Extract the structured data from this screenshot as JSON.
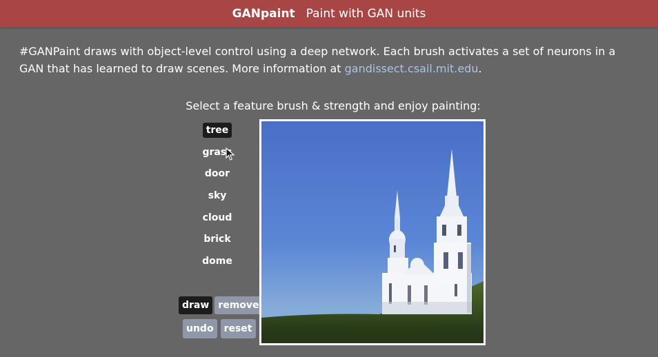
{
  "header": {
    "brand": "GANpaint",
    "subtitle": "Paint with GAN units"
  },
  "intro": {
    "text": "#GANPaint draws with object-level control using a deep network. Each brush activates a set of neurons in a GAN that has learned to draw scenes. More information at ",
    "link": "gandissect.csail.mit.edu",
    "suffix": "."
  },
  "prompt": "Select a feature brush & strength and enjoy painting:",
  "brushes": [
    {
      "label": "tree",
      "selected": true
    },
    {
      "label": "grass",
      "selected": false
    },
    {
      "label": "door",
      "selected": false
    },
    {
      "label": "sky",
      "selected": false
    },
    {
      "label": "cloud",
      "selected": false
    },
    {
      "label": "brick",
      "selected": false
    },
    {
      "label": "dome",
      "selected": false
    }
  ],
  "modes": {
    "draw": "draw",
    "remove": "remove",
    "active": "draw"
  },
  "actions": {
    "undo": "undo",
    "reset": "reset"
  },
  "colors": {
    "header": "#a84545",
    "background": "#666666",
    "selected": "#1c1c1c",
    "button": "#8f97a8",
    "link": "#a9c4e6"
  },
  "icons": {
    "cursor": "arrow-cursor-icon"
  }
}
